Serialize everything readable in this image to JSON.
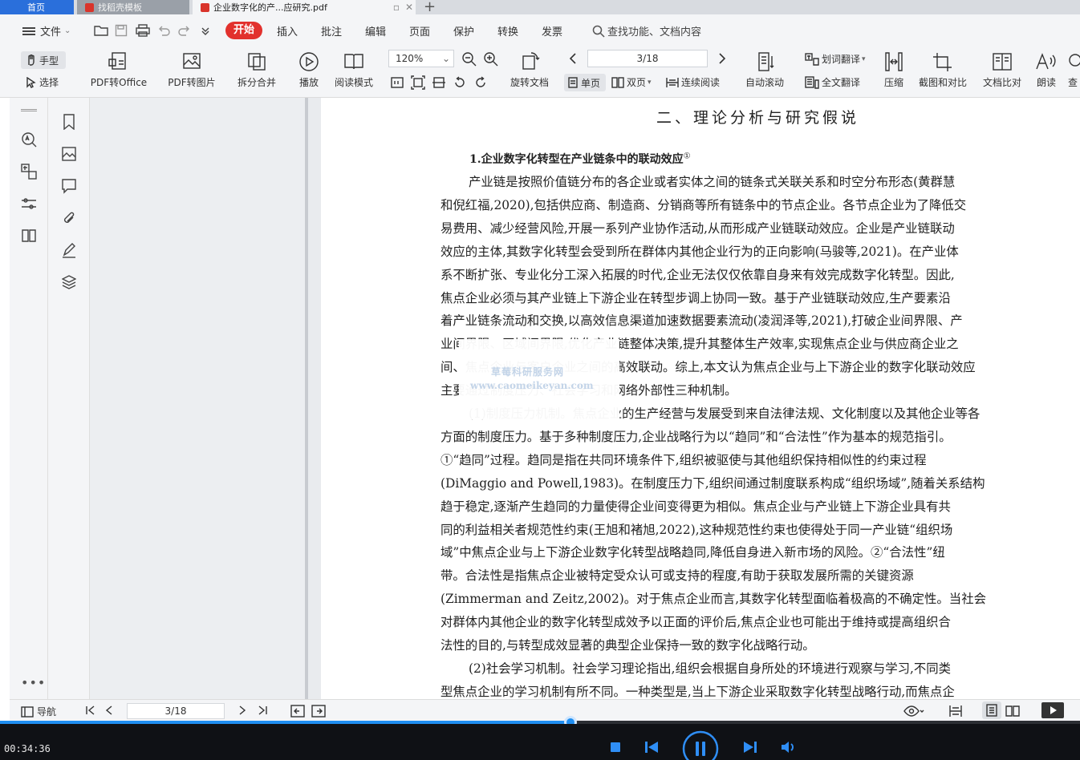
{
  "tabs": {
    "home": "首页",
    "template": "找稻壳模板",
    "document": "企业数字化的产...应研究.pdf"
  },
  "menu": {
    "file": "文件",
    "start": "开始",
    "insert": "插入",
    "annotate": "批注",
    "edit": "编辑",
    "page": "页面",
    "protect": "保护",
    "convert": "转换",
    "invoice": "发票",
    "search_placeholder": "查找功能、文档内容"
  },
  "toolbar": {
    "hand": "手型",
    "select": "选择",
    "pdf_to_office": "PDF转Office",
    "pdf_to_image": "PDF转图片",
    "split_merge": "拆分合并",
    "play": "播放",
    "read_mode": "阅读模式",
    "zoom": "120%",
    "rotate": "旋转文档",
    "page_indicator": "3/18",
    "single_page": "单页",
    "double_page": "双页",
    "continuous": "连续阅读",
    "auto_scroll": "自动滚动",
    "word_translate": "划词翻译",
    "full_translate": "全文翻译",
    "compress": "压缩",
    "screenshot_compare": "截图和对比",
    "doc_compare": "文档比对",
    "read_aloud": "朗读",
    "find": "查"
  },
  "document": {
    "heading": "二、理论分析与研究假说",
    "subheading": "1.企业数字化转型在产业链条中的联动效应",
    "subheading_note": "①",
    "lines": [
      "产业链是按照价值链分布的各企业或者实体之间的链条式关联关系和时空分布形态(黄群慧",
      "和倪红福,2020),包括供应商、制造商、分销商等所有链条中的节点企业。各节点企业为了降低交",
      "易费用、减少经营风险,开展一系列产业协作活动,从而形成产业链联动效应。企业是产业链联动",
      "效应的主体,其数字化转型会受到所在群体内其他企业行为的正向影响(马骏等,2021)。在产业体",
      "系不断扩张、专业化分工深入拓展的时代,企业无法仅仅依靠自身来有效完成数字化转型。因此,",
      "焦点企业必须与其产业链上下游企业在转型步调上协同一致。基于产业链联动效应,生产要素沿",
      "着产业链条流动和交换,以高效信息渠道加速数据要素流动(凌润泽等,2021),打破企业间界限、产",
      "业间界限、区域间界限,优化产业链整体决策,提升其整体生产效率,实现焦点企业与供应商企业之",
      "间、焦点企业与客户企业之间的高效联动。综上,本文认为焦点企业与上下游企业的数字化联动效应",
      "主要通过制度压力、社会学习和网络外部性三种机制。",
      "(1)制度压力机制。焦点企业的生产经营与发展受到来自法律法规、文化制度以及其他企业等各",
      "方面的制度压力。基于多种制度压力,企业战略行为以“趋同”和“合法性”作为基本的规范指引。",
      "①“趋同”过程。趋同是指在共同环境条件下,组织被驱使与其他组织保持相似性的约束过程",
      "(DiMaggio and Powell,1983)。在制度压力下,组织间通过制度联系构成“组织场域”,随着关系结构",
      "趋于稳定,逐渐产生趋同的力量使得企业间变得更为相似。焦点企业与产业链上下游企业具有共",
      "同的利益相关者规范性约束(王旭和褚旭,2022),这种规范性约束也使得处于同一产业链“组织场",
      "域”中焦点企业与上下游企业数字化转型战略趋同,降低自身进入新市场的风险。②“合法性”纽",
      "带。合法性是指焦点企业被特定受众认可或支持的程度,有助于获取发展所需的关键资源",
      "(Zimmerman and Zeitz,2002)。对于焦点企业而言,其数字化转型面临着极高的不确定性。当社会",
      "对群体内其他企业的数字化转型成效予以正面的评价后,焦点企业也可能出于维持或提高组织合",
      "法性的目的,与转型成效显著的典型企业保持一致的数字化战略行动。",
      "(2)社会学习机制。社会学习理论指出,组织会根据自身所处的环境进行观察与学习,不同类",
      "型焦点企业的学习机制有所不同。一种类型是,当上下游企业采取数字化转型战略行动,而焦点企"
    ],
    "watermark_cn": "草莓科研服务网",
    "watermark_en": "www.caomeikeyan.com"
  },
  "statusbar": {
    "nav": "导航",
    "page_indicator": "3/18"
  },
  "player": {
    "time": "00:34:36",
    "progress": 0.528
  }
}
